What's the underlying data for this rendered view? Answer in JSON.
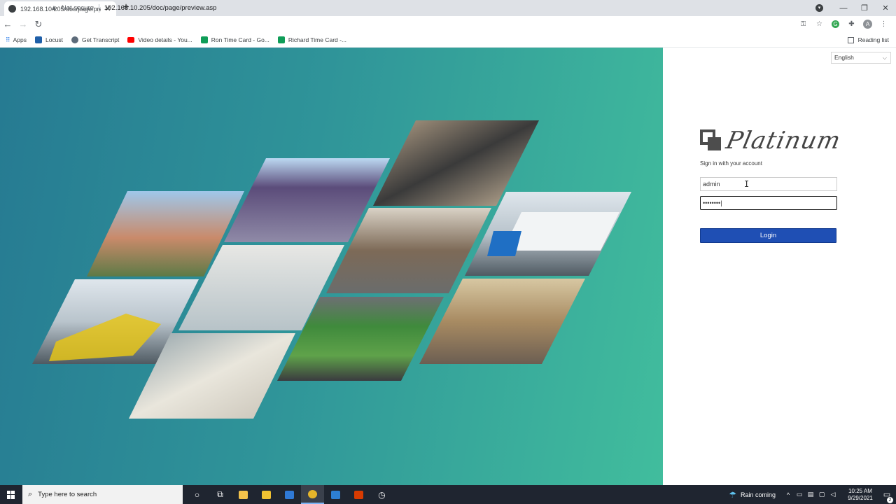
{
  "browser": {
    "tab": {
      "title": "192.168.10.205/doc/page/previe",
      "close": "✕"
    },
    "new_tab": "+",
    "window_controls": {
      "minimize": "—",
      "restore": "❐",
      "close": "✕"
    },
    "address": {
      "security": "Not secure",
      "url": "192.168.10.205/doc/page/preview.asp"
    },
    "bookmarks": [
      {
        "label": "Apps",
        "color": "#1a73e8"
      },
      {
        "label": "Locust",
        "color": "#1f5fa8"
      },
      {
        "label": "Get Transcript",
        "color": "#5d6b7a"
      },
      {
        "label": "Video details - You...",
        "color": "#ff0000"
      },
      {
        "label": "Ron Time Card - Go...",
        "color": "#0f9d58"
      },
      {
        "label": "Richard Time Card -...",
        "color": "#0f9d58"
      }
    ],
    "reading_list": "Reading list",
    "profile_initial": "A"
  },
  "login": {
    "language": "English",
    "brand": "Platinum",
    "subtitle": "Sign in with your account",
    "username": "admin",
    "password_mask": "••••••••|",
    "button": "Login"
  },
  "colors": {
    "hero_start": "#267a92",
    "hero_end": "#41bd9d",
    "login_button": "#1f4fb4"
  },
  "taskbar": {
    "search_placeholder": "Type here to search",
    "weather": "Rain coming",
    "time": "10:25 AM",
    "date": "9/29/2021",
    "notification_count": "2",
    "mail_badge": "2"
  }
}
